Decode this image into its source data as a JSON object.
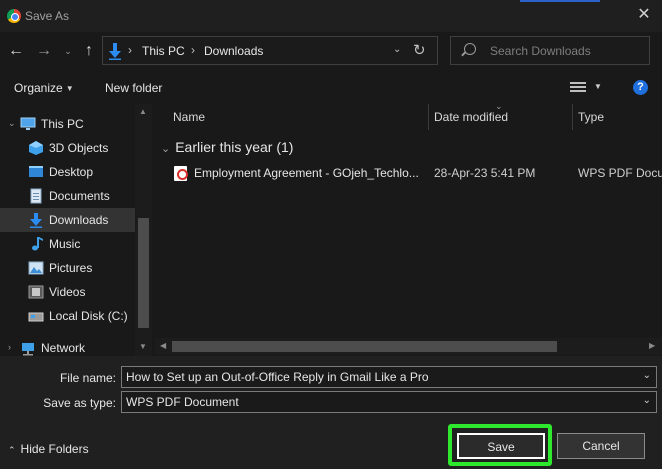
{
  "window": {
    "title": "Save As"
  },
  "nav": {
    "breadcrumbs": [
      "This PC",
      "Downloads"
    ],
    "search_placeholder": "Search Downloads"
  },
  "toolbar": {
    "organize": "Organize",
    "new_folder": "New folder"
  },
  "sidebar": {
    "items": [
      {
        "label": "This PC",
        "icon": "monitor-icon"
      },
      {
        "label": "3D Objects",
        "icon": "cube-icon"
      },
      {
        "label": "Desktop",
        "icon": "desktop-icon"
      },
      {
        "label": "Documents",
        "icon": "document-icon"
      },
      {
        "label": "Downloads",
        "icon": "download-icon",
        "selected": true
      },
      {
        "label": "Music",
        "icon": "music-note-icon"
      },
      {
        "label": "Pictures",
        "icon": "picture-icon"
      },
      {
        "label": "Videos",
        "icon": "film-icon"
      },
      {
        "label": "Local Disk (C:)",
        "icon": "drive-icon"
      },
      {
        "label": "Network",
        "icon": "network-icon"
      }
    ]
  },
  "filelist": {
    "columns": [
      "Name",
      "Date modified",
      "Type"
    ],
    "group": "Earlier this year (1)",
    "files": [
      {
        "name": "Employment Agreement - GOjeh_Techlo...",
        "date": "28-Apr-23 5:41 PM",
        "type": "WPS PDF Docum"
      }
    ]
  },
  "form": {
    "file_name_label": "File name:",
    "file_name_value": "How to Set up an Out-of-Office Reply in Gmail Like a Pro",
    "save_type_label": "Save as type:",
    "save_type_value": "WPS PDF Document"
  },
  "footer": {
    "hide_folders": "Hide Folders",
    "save": "Save",
    "cancel": "Cancel"
  },
  "colors": {
    "highlight": "#2ee82e",
    "accent": "#1f6fdc"
  }
}
